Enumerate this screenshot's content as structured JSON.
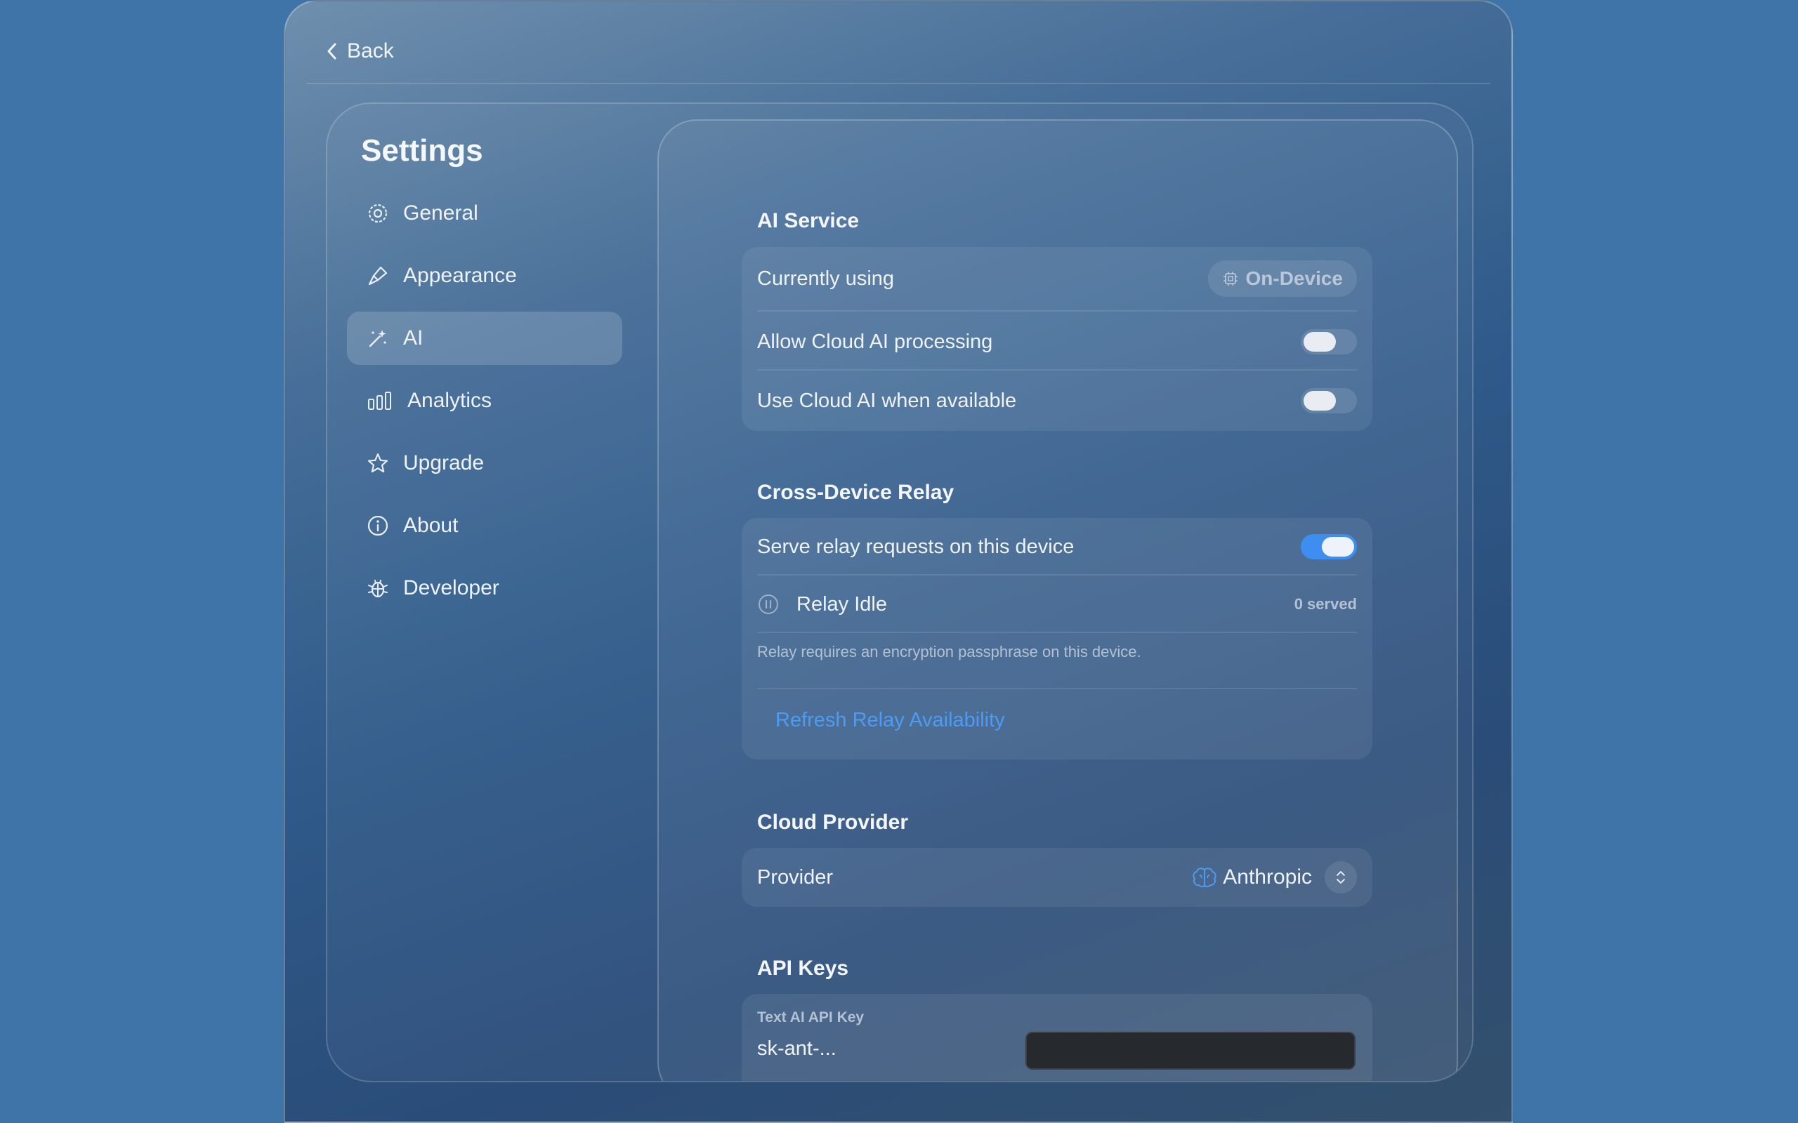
{
  "topbar": {
    "back_label": "Back"
  },
  "sidebar": {
    "title": "Settings",
    "items": [
      {
        "label": "General",
        "icon": "gear-icon"
      },
      {
        "label": "Appearance",
        "icon": "paintbrush-icon"
      },
      {
        "label": "AI",
        "icon": "magic-wand-icon",
        "active": true
      },
      {
        "label": "Analytics",
        "icon": "bar-chart-icon"
      },
      {
        "label": "Upgrade",
        "icon": "star-icon"
      },
      {
        "label": "About",
        "icon": "info-icon"
      },
      {
        "label": "Developer",
        "icon": "bug-icon"
      }
    ]
  },
  "ai_service": {
    "title": "AI Service",
    "currently_using_label": "Currently using",
    "currently_using_value": "On-Device",
    "allow_cloud_label": "Allow Cloud AI processing",
    "allow_cloud_on": false,
    "use_cloud_label": "Use Cloud AI when available",
    "use_cloud_on": false
  },
  "relay": {
    "title": "Cross-Device Relay",
    "serve_label": "Serve relay requests on this device",
    "serve_on": true,
    "status_label": "Relay Idle",
    "served_count": "0 served",
    "note": "Relay requires an encryption passphrase on this device.",
    "refresh_label": "Refresh Relay Availability"
  },
  "cloud_provider": {
    "title": "Cloud Provider",
    "provider_label": "Provider",
    "provider_value": "Anthropic"
  },
  "api_keys": {
    "title": "API Keys",
    "text_key_label": "Text AI API Key",
    "text_key_value": "sk-ant-...",
    "text_key_field_value": ""
  },
  "colors": {
    "accent": "#3d8ef0",
    "link": "#4d9bf2",
    "background": "#3f74a8"
  }
}
